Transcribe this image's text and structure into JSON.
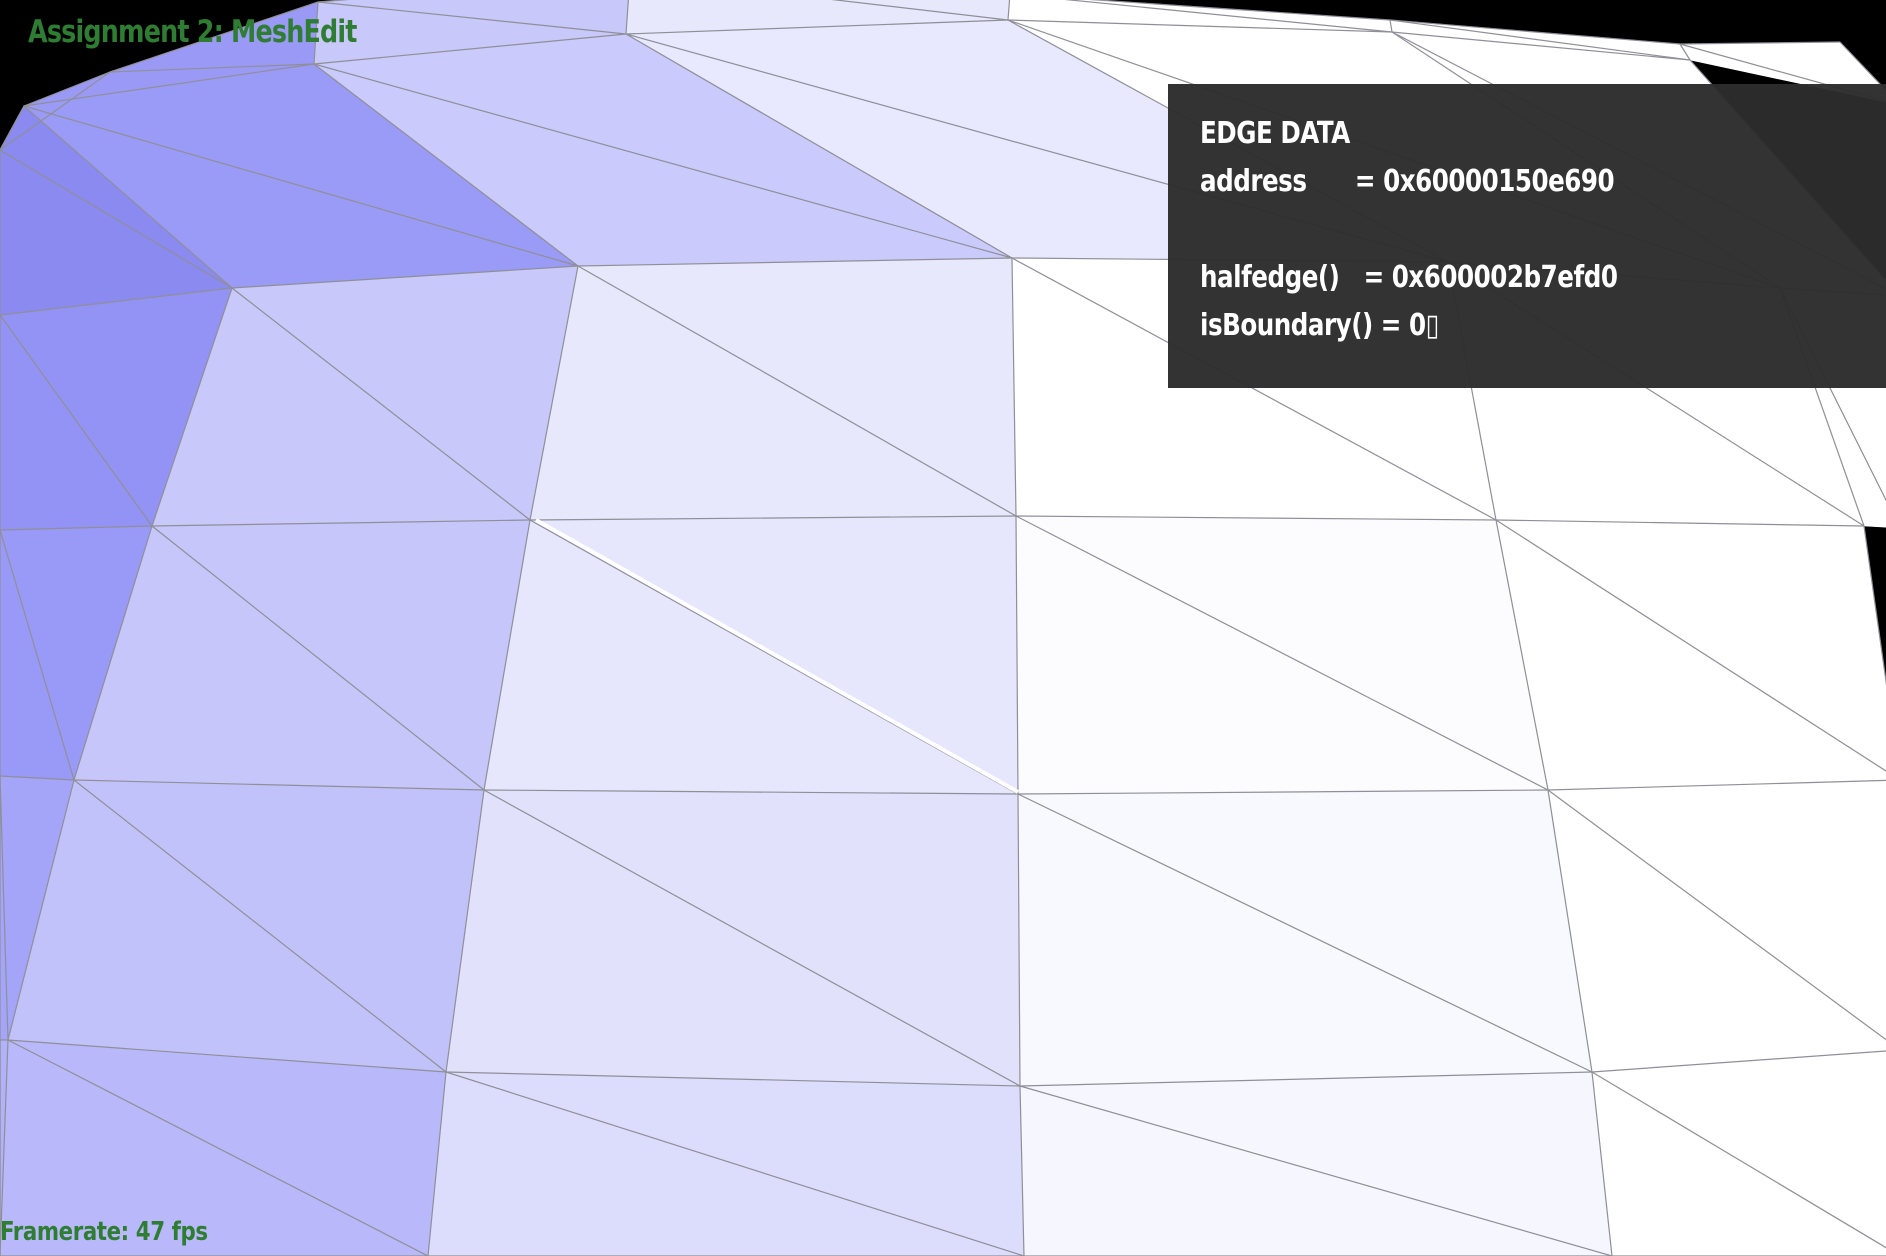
{
  "app": {
    "title": "Assignment 2: MeshEdit",
    "framerate": "Framerate: 47 fps"
  },
  "edge_panel": {
    "heading": "EDGE DATA",
    "address": "address      = 0x60000150e690",
    "halfedge": "halfedge()   = 0x600002b7efd0",
    "is_boundary": "isBoundary() = 0▯"
  },
  "colors": {
    "background": "#000000",
    "title_text": "#2e7d32",
    "panel_bg": "#2c2c2c",
    "panel_text": "#ffffff",
    "mesh_edge": "#8f8f98",
    "selected_edge": "#ffffff"
  }
}
